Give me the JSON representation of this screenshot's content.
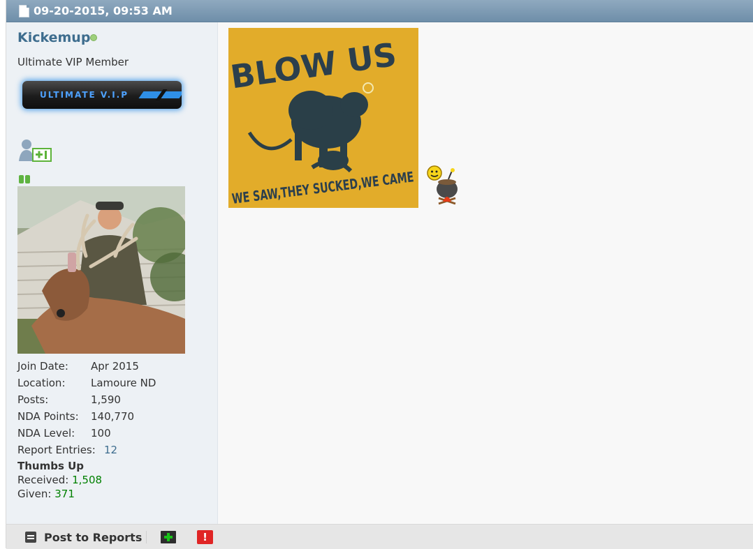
{
  "post": {
    "date": "09-20-2015, 09:53 AM"
  },
  "user": {
    "username": "Kickemup",
    "title": "Ultimate VIP Member",
    "badge_text": "ULTIMATE V.I.P",
    "stats": [
      {
        "label": "Join Date:",
        "value": "Apr 2015"
      },
      {
        "label": "Location:",
        "value": "Lamoure ND"
      },
      {
        "label": "Posts:",
        "value": "1,590"
      },
      {
        "label": "NDA Points:",
        "value": "140,770"
      },
      {
        "label": "NDA Level:",
        "value": "100"
      },
      {
        "label": "Report Entries:",
        "value": "12"
      }
    ],
    "thumbs": {
      "title": "Thumbs Up",
      "received_label": "Received:",
      "received_value": "1,508",
      "given_label": "Given:",
      "given_value": "371"
    }
  },
  "content": {
    "image_top_text": "BLOW US",
    "image_bottom_text": "WE SAW,THEY SUCKED,WE CAME"
  },
  "footer": {
    "post_to_reports": "Post to Reports",
    "alert_symbol": "!"
  },
  "colors": {
    "header": "#7b98b1",
    "username": "#3e6d8e",
    "thumbs_value": "#008000",
    "image_background": "#e2ac2a"
  }
}
